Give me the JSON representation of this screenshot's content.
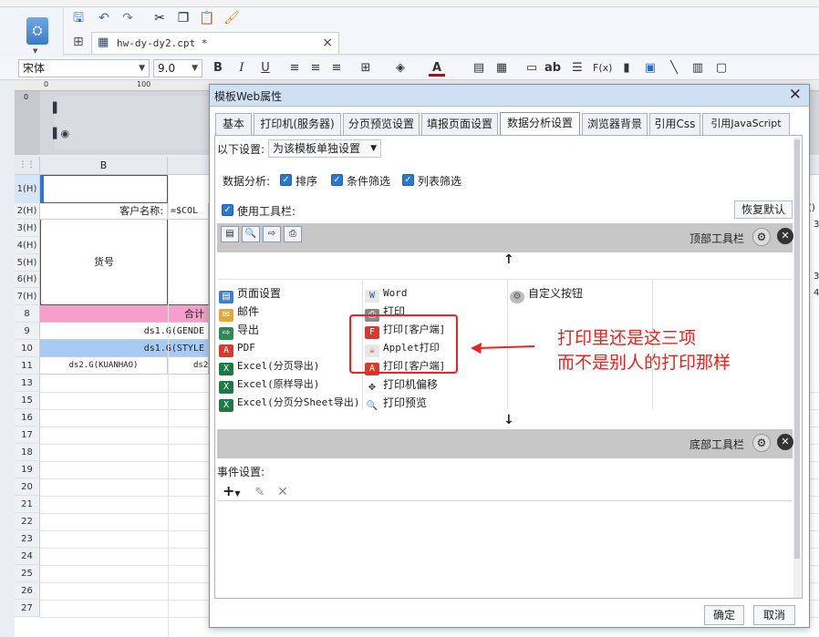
{
  "file_tab": {
    "title": "hw-dy-dy2.cpt *"
  },
  "format_toolbar": {
    "font_name": "宋体",
    "font_size": "9.0",
    "bold": "B",
    "italic": "I",
    "underline": "U",
    "text_ab": "ab",
    "formula": "F(x)"
  },
  "ruler": {
    "ticks": [
      "0",
      "100"
    ]
  },
  "design_band": {
    "marks": [
      "0"
    ]
  },
  "sheet": {
    "column_header": "B",
    "rows": [
      "1(H)",
      "2(H)",
      "3(H)",
      "4(H)",
      "5(H)",
      "6(H)",
      "7(H)",
      "8",
      "9",
      "10",
      "11",
      "13",
      "15",
      "16",
      "17",
      "18",
      "19",
      "20",
      "21",
      "22",
      "23",
      "24",
      "25",
      "26",
      "27"
    ],
    "cells": {
      "customer_label": "客户名称:",
      "customer_value": "=$COL",
      "goods_no": "货号",
      "total": "合计",
      "gender_expr": "ds1.G(GENDE",
      "style_expr": "ds1.G(STYLE",
      "kuanhao_expr": "ds2.G(KUANHAO)",
      "ds2_prefix": "ds2"
    },
    "right_edge": [
      "()",
      "3",
      "3",
      "4"
    ]
  },
  "dialog": {
    "title": "模板Web属性",
    "tabs": [
      "基本",
      "打印机(服务器)",
      "分页预览设置",
      "填报页面设置",
      "数据分析设置",
      "浏览器背景",
      "引用Css",
      "引用JavaScript"
    ],
    "active_tab": "数据分析设置",
    "scope_label": "以下设置:",
    "scope_value": "为该模板单独设置",
    "analysis_label": "数据分析:",
    "analysis_options": [
      {
        "label": "排序",
        "checked": true
      },
      {
        "label": "条件筛选",
        "checked": true
      },
      {
        "label": "列表筛选",
        "checked": true
      }
    ],
    "use_toolbar_label": "使用工具栏:",
    "use_toolbar_checked": true,
    "restore_default": "恢复默认",
    "top_toolbar_label": "顶部工具栏",
    "bottom_toolbar_label": "底部工具栏",
    "items_col1": [
      "页面设置",
      "邮件",
      "导出",
      "PDF",
      "Excel(分页导出)",
      "Excel(原样导出)",
      "Excel(分页分Sheet导出)"
    ],
    "items_col2": [
      "Word",
      "打印",
      "打印[客户端]",
      "Applet打印",
      "打印[客户端]",
      "打印机偏移",
      "打印预览"
    ],
    "items_col3": [
      "自定义按钮"
    ],
    "event_settings_label": "事件设置:",
    "ok": "确定",
    "cancel": "取消"
  },
  "annotation": {
    "line1": "打印里还是这三项",
    "line2": "而不是别人的打印那样",
    "color": "#e0261f"
  }
}
